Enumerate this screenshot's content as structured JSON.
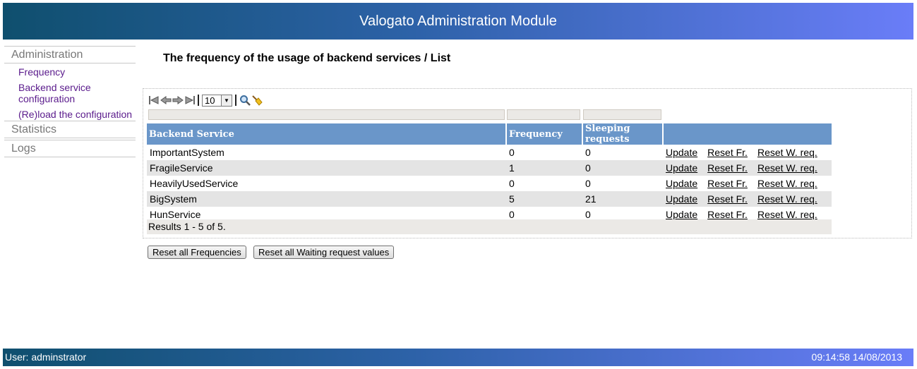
{
  "header": {
    "title": "Valogato Administration Module"
  },
  "sidebar": {
    "administration": "Administration",
    "links": [
      "Frequency",
      "Backend service configuration",
      "(Re)load the configuration"
    ],
    "statistics": "Statistics",
    "logs": "Logs"
  },
  "page": {
    "heading": "The frequency of the usage of backend services / List"
  },
  "toolbar": {
    "page_size": "10",
    "icons": [
      "first-page-icon",
      "prev-page-icon",
      "next-page-icon",
      "last-page-icon",
      "search-icon",
      "clear-filter-broom-icon"
    ]
  },
  "table": {
    "columns": [
      "Backend Service",
      "Frequency",
      "Sleeping requests"
    ],
    "actions": [
      "Update",
      "Reset Fr.",
      "Reset W. req."
    ],
    "rows": [
      {
        "service": "ImportantSystem",
        "frequency": "0",
        "sleeping": "0"
      },
      {
        "service": "FragileService",
        "frequency": "1",
        "sleeping": "0"
      },
      {
        "service": "HeavilyUsedService",
        "frequency": "0",
        "sleeping": "0"
      },
      {
        "service": "BigSystem",
        "frequency": "5",
        "sleeping": "21"
      },
      {
        "service": "HunService",
        "frequency": "0",
        "sleeping": "0"
      }
    ],
    "results": "Results 1 - 5 of 5."
  },
  "buttons": {
    "reset_frequencies": "Reset all Frequencies",
    "reset_waiting": "Reset all Waiting request values"
  },
  "status": {
    "user": "User: adminstrator",
    "datetime": "09:14:58 14/08/2013"
  },
  "colors": {
    "header_start": "#0f4f6e",
    "header_end": "#6a7df8",
    "table_header": "#6a96c9",
    "link": "#5a1b8c"
  }
}
